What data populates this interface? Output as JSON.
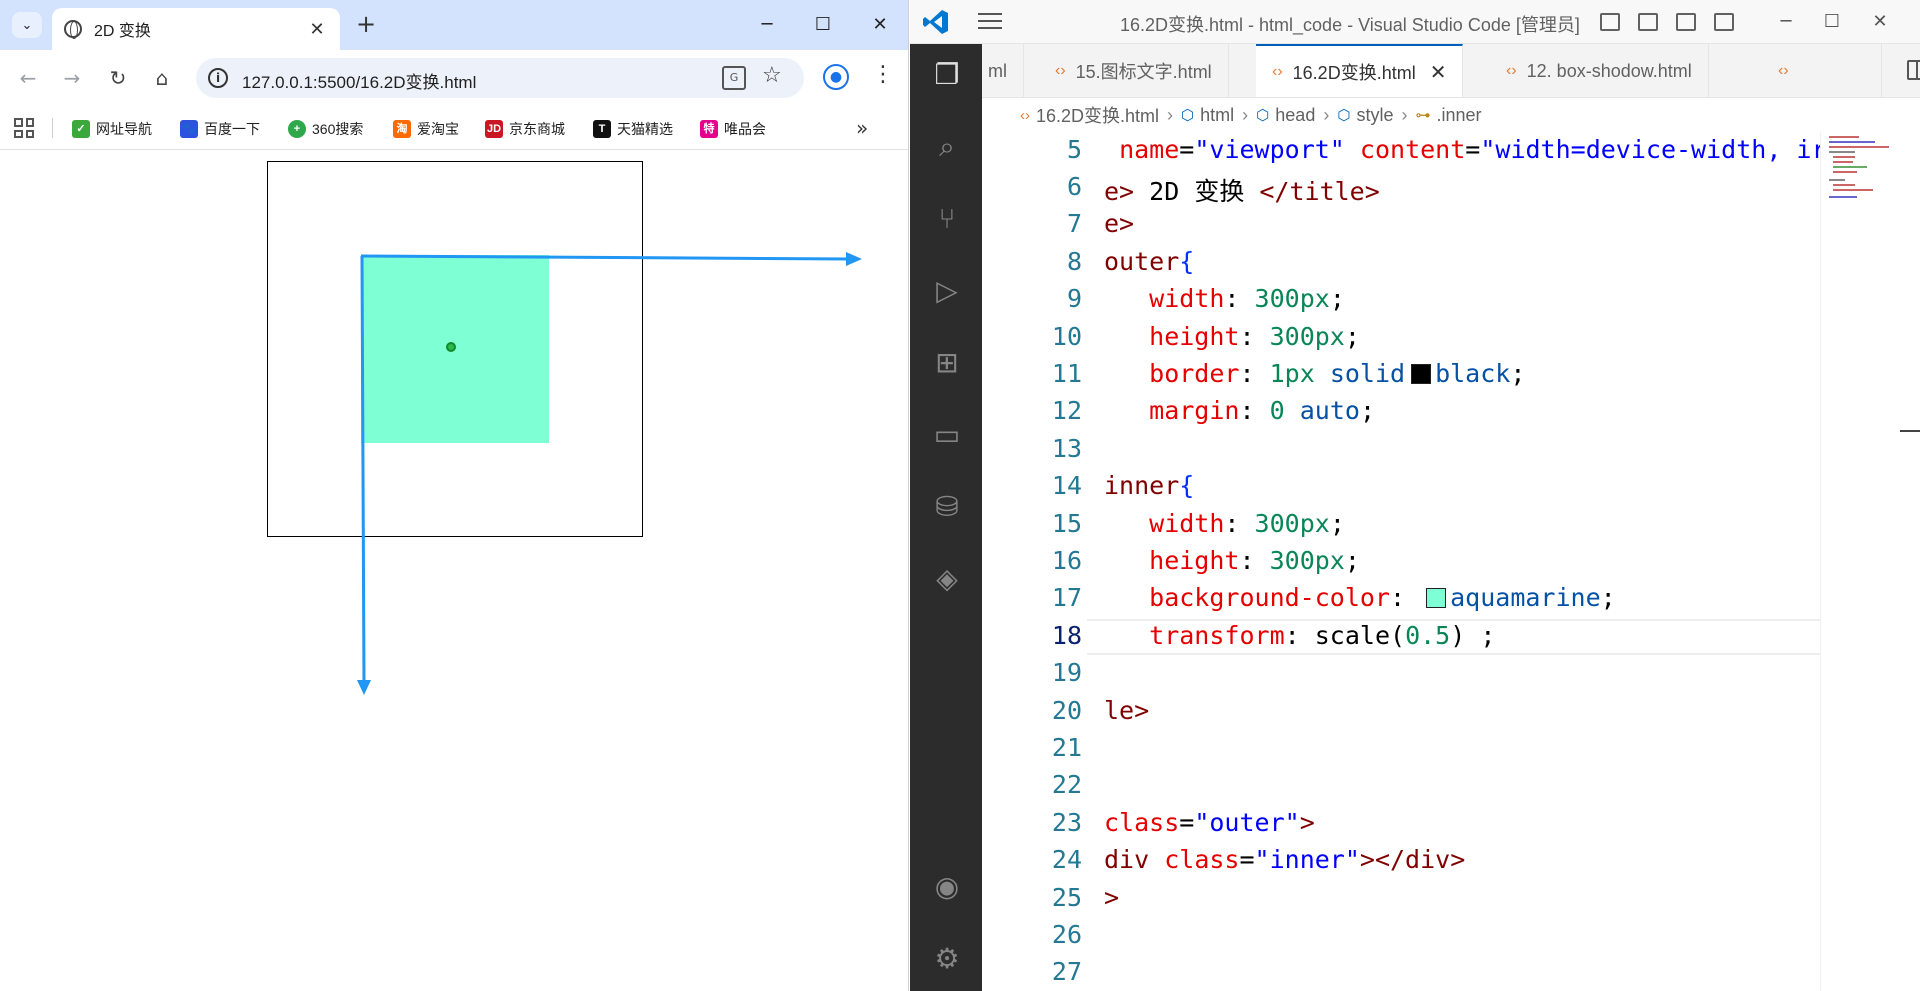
{
  "browser": {
    "tab_title": "2D 变换",
    "url": "127.0.0.1:5500/16.2D变换.html",
    "bookmarks": [
      "网址导航",
      "百度一下",
      "360搜索",
      "爱淘宝",
      "京东商城",
      "天猫精选",
      "唯品会"
    ],
    "colors": {
      "inner": "#7fffd4",
      "arrow": "#2196f3",
      "dot": "#2db84a"
    }
  },
  "vscode": {
    "window_title": "16.2D变换.html - html_code - Visual Studio Code [管理员]",
    "tabs": [
      "ml",
      "15.图标文字.html",
      "16.2D变换.html",
      "12. box-shodow.html"
    ],
    "breadcrumb": [
      "16.2D变换.html",
      "html",
      "head",
      "style",
      ".inner"
    ],
    "line_numbers": [
      "5",
      "6",
      "7",
      "8",
      "9",
      "10",
      "11",
      "12",
      "13",
      "14",
      "15",
      "16",
      "17",
      "18",
      "19",
      "20",
      "21",
      "22",
      "23",
      "24",
      "25",
      "26",
      "27"
    ],
    "current_line": "18"
  }
}
